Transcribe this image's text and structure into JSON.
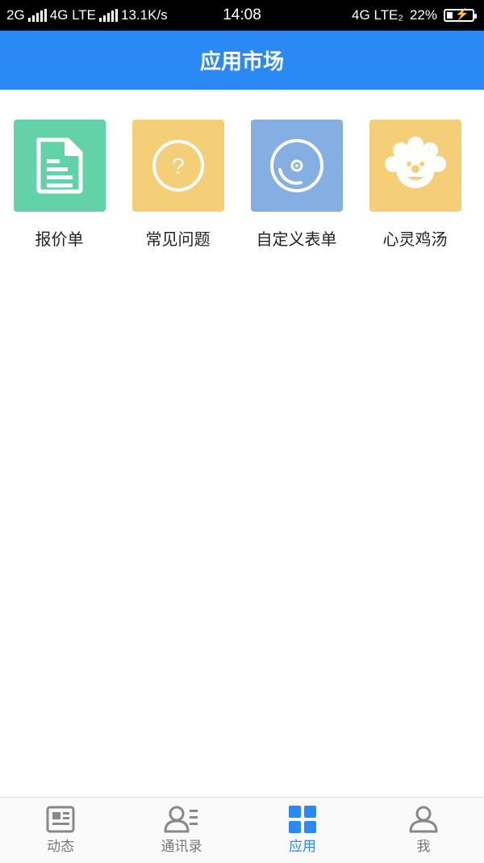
{
  "status_bar": {
    "sim1": "2G",
    "sim2": "4G LTE",
    "speed": "13.1K/s",
    "time": "14:08",
    "network_right": "4G LTE₂",
    "battery": "22%"
  },
  "header": {
    "title": "应用市场"
  },
  "apps": [
    {
      "label": "报价单",
      "color": "#63d2a8",
      "icon": "document-icon"
    },
    {
      "label": "常见问题",
      "color": "#f5cf78",
      "icon": "question-icon"
    },
    {
      "label": "自定义表单",
      "color": "#85aee3",
      "icon": "disc-icon"
    },
    {
      "label": "心灵鸡汤",
      "color": "#f5cf78",
      "icon": "flower-face-icon"
    }
  ],
  "bottom_nav": [
    {
      "label": "动态",
      "icon": "news-icon",
      "active": false
    },
    {
      "label": "通讯录",
      "icon": "contacts-icon",
      "active": false
    },
    {
      "label": "应用",
      "icon": "apps-grid-icon",
      "active": true
    },
    {
      "label": "我",
      "icon": "person-icon",
      "active": false
    }
  ],
  "colors": {
    "accent": "#2a89f5"
  }
}
